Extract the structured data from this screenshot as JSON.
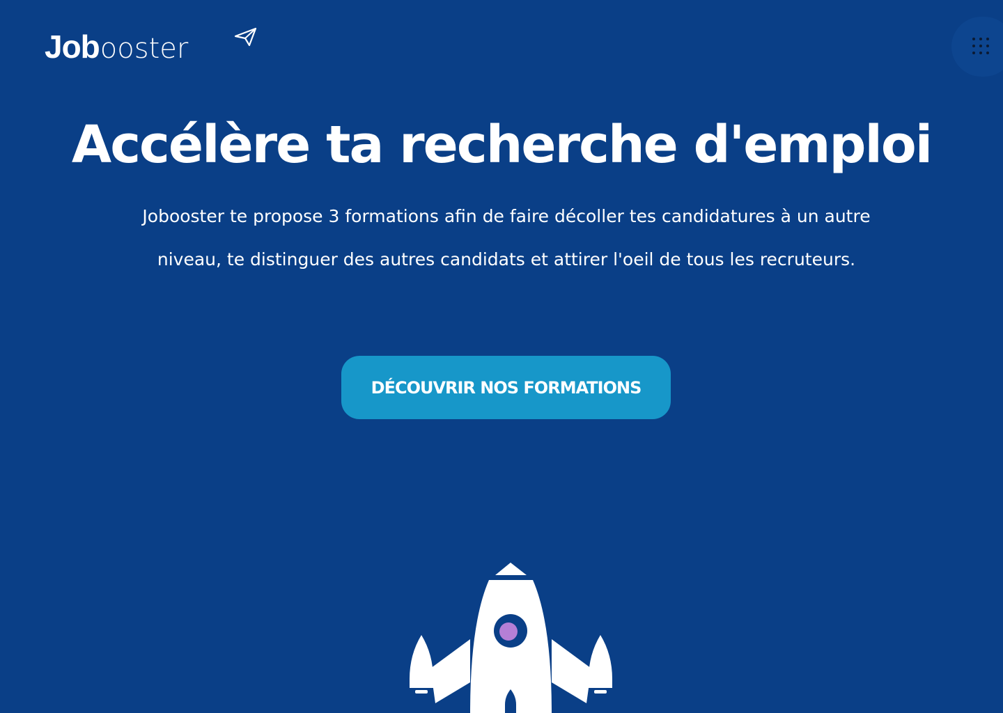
{
  "header": {
    "logo_bold": "Job",
    "logo_light": "ooster",
    "menu_icon": "grid-dots-icon"
  },
  "hero": {
    "title": "Accélère ta recherche d'emploi",
    "description": "Jobooster te propose 3 formations afin de faire décoller tes candidatures à un autre niveau, te distinguer des autres candidats et attirer l'oeil de tous les recruteurs.",
    "cta_label": "DÉCOUVRIR NOS FORMATIONS",
    "illustration": "rocket-icon"
  },
  "colors": {
    "background": "#0a3f87",
    "button": "#1797c9",
    "text": "#ffffff",
    "rocket_window": "#b57fd6"
  }
}
